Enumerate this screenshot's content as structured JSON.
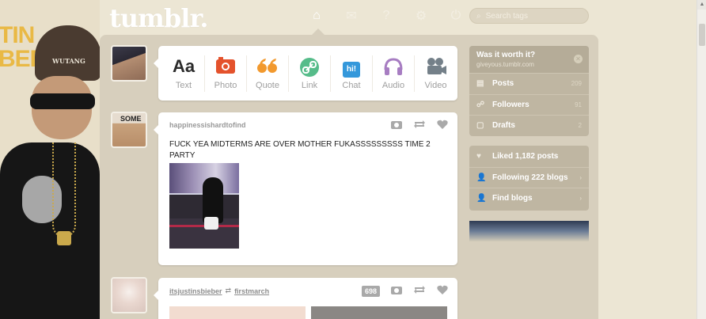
{
  "app": {
    "logo": "tumblr."
  },
  "background": {
    "text_line1": "TIN",
    "text_line2": "BER",
    "cap_text": "WUTANG"
  },
  "nav": {
    "items": [
      {
        "name": "home",
        "glyph": "⌂"
      },
      {
        "name": "inbox",
        "glyph": "✉"
      },
      {
        "name": "help",
        "glyph": "?"
      },
      {
        "name": "settings",
        "glyph": "⚙"
      },
      {
        "name": "logout",
        "glyph": "⏻"
      }
    ],
    "search_placeholder": "Search tags"
  },
  "post_types": [
    {
      "label": "Text",
      "glyph": "Aa",
      "color": "#2b2b2b"
    },
    {
      "label": "Photo",
      "glyph": "📷",
      "color": "#e4522c"
    },
    {
      "label": "Quote",
      "glyph": "❝",
      "color": "#f2992e"
    },
    {
      "label": "Link",
      "glyph": "🔗",
      "color": "#56bc8a"
    },
    {
      "label": "Chat",
      "glyph": "hi!",
      "color": "#3498db"
    },
    {
      "label": "Audio",
      "glyph": "🎧",
      "color": "#a77dc2"
    },
    {
      "label": "Video",
      "glyph": "🎥",
      "color": "#748089"
    }
  ],
  "posts": [
    {
      "author": "happinessishardtofind",
      "text": "FUCK YEA MIDTERMS ARE OVER MOTHER FUKASSSSSSSSS TIME 2 PARTY",
      "avatar_text": "SOME"
    },
    {
      "author": "itsjustinsbieber",
      "reblogged_from": "firstmarch",
      "notes": "698"
    }
  ],
  "sidebar": {
    "blog_title": "Was it worth it?",
    "blog_url": "giveyous.tumblr.com",
    "stats": [
      {
        "label": "Posts",
        "count": "209",
        "icon": "▤"
      },
      {
        "label": "Followers",
        "count": "91",
        "icon": "☍"
      },
      {
        "label": "Drafts",
        "count": "2",
        "icon": "▢"
      }
    ],
    "links": [
      {
        "label": "Liked 1,182 posts",
        "icon": "♥"
      },
      {
        "label": "Following 222 blogs",
        "icon": "👤"
      },
      {
        "label": "Find blogs",
        "icon": "👤"
      }
    ]
  }
}
